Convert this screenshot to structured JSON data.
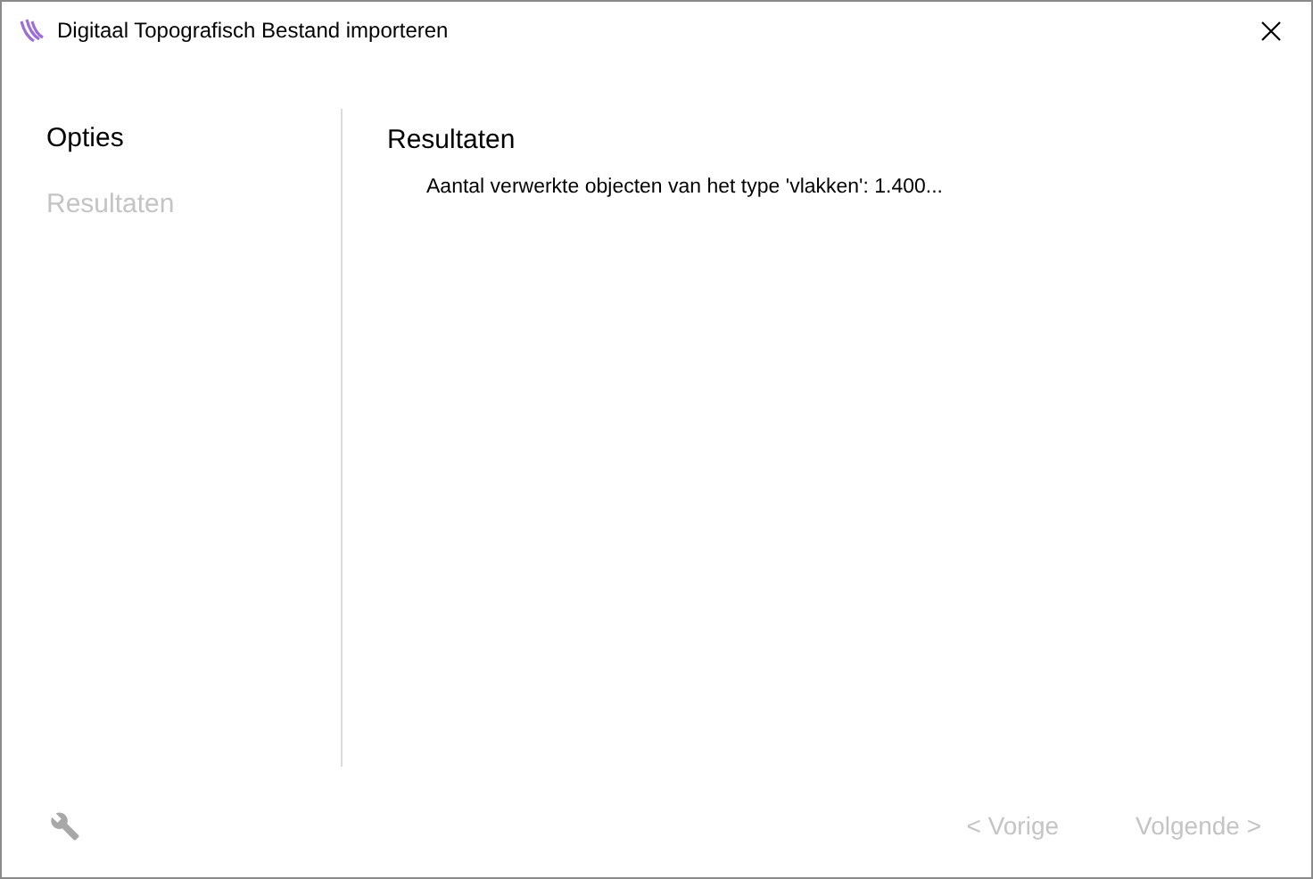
{
  "window": {
    "title": "Digitaal Topografisch Bestand importeren"
  },
  "sidebar": {
    "items": [
      {
        "label": "Opties",
        "disabled": false
      },
      {
        "label": "Resultaten",
        "disabled": true
      }
    ]
  },
  "content": {
    "heading": "Resultaten",
    "lines": [
      "Aantal verwerkte objecten van het type 'vlakken': 1.400..."
    ]
  },
  "footer": {
    "buttons": [
      {
        "label": "< Vorige",
        "disabled": true
      },
      {
        "label": "Volgende >",
        "disabled": true
      }
    ]
  }
}
